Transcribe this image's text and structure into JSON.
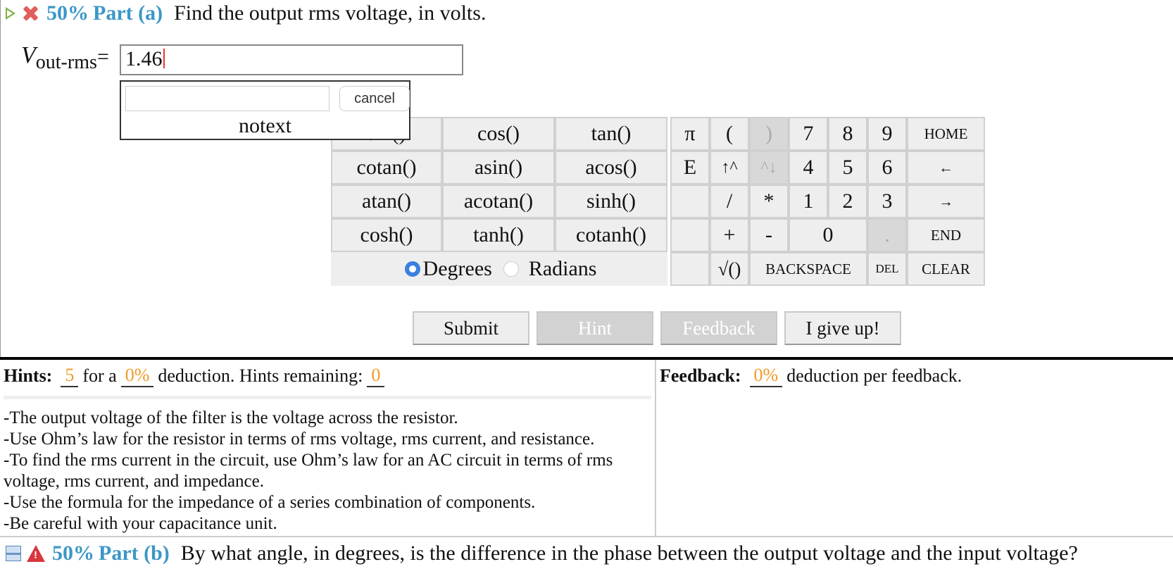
{
  "part_a": {
    "percent": "50%",
    "label": "Part (a)",
    "question": "Find the output rms voltage, in volts."
  },
  "answer": {
    "var_main": "V",
    "var_sub": "out-rms",
    "equals": "=",
    "value": "1.46"
  },
  "popup": {
    "cancel": "cancel",
    "notext": "notext"
  },
  "keypad": {
    "func_rows": [
      [
        "sin()",
        "cos()",
        "tan()"
      ],
      [
        "cotan()",
        "asin()",
        "acos()"
      ],
      [
        "atan()",
        "acotan()",
        "sinh()"
      ],
      [
        "cosh()",
        "tanh()",
        "cotanh()"
      ]
    ],
    "degrees": "Degrees",
    "radians": "Radians",
    "pi": "π",
    "open_paren": "(",
    "close_paren": ")",
    "e": "E",
    "up": "↑^",
    "down": "^↓",
    "slash": "/",
    "star": "*",
    "plus": "+",
    "minus": "-",
    "sqrt": "√()",
    "d7": "7",
    "d8": "8",
    "d9": "9",
    "d4": "4",
    "d5": "5",
    "d6": "6",
    "d1": "1",
    "d2": "2",
    "d3": "3",
    "d0": "0",
    "dot": ".",
    "home": "HOME",
    "left": "←",
    "right": "→",
    "end": "END",
    "backspace": "BACKSPACE",
    "del": "DEL",
    "clear": "CLEAR"
  },
  "buttons": {
    "submit": "Submit",
    "hint": "Hint",
    "feedback": "Feedback",
    "giveup": "I give up!"
  },
  "hints": {
    "label": "Hints:",
    "count": "5",
    "for_a": "for a",
    "deduction": "0%",
    "remaining_text": "deduction. Hints remaining:",
    "remaining": "0",
    "items": [
      "-The output voltage of the filter is the voltage across the resistor.",
      "-Use Ohm’s law for the resistor in terms of rms voltage, rms current, and resistance.",
      "-To find the rms current in the circuit, use Ohm’s law for an AC circuit in terms of rms voltage, rms current, and impedance.",
      "-Use the formula for the impedance of a series combination of components.",
      "-Be careful with your capacitance unit."
    ]
  },
  "feedback": {
    "label": "Feedback:",
    "deduction": "0%",
    "text": "deduction per feedback."
  },
  "part_b": {
    "percent": "50%",
    "label": "Part (b)",
    "question": "By what angle, in degrees, is the difference in the phase between the output voltage and the input voltage?"
  }
}
